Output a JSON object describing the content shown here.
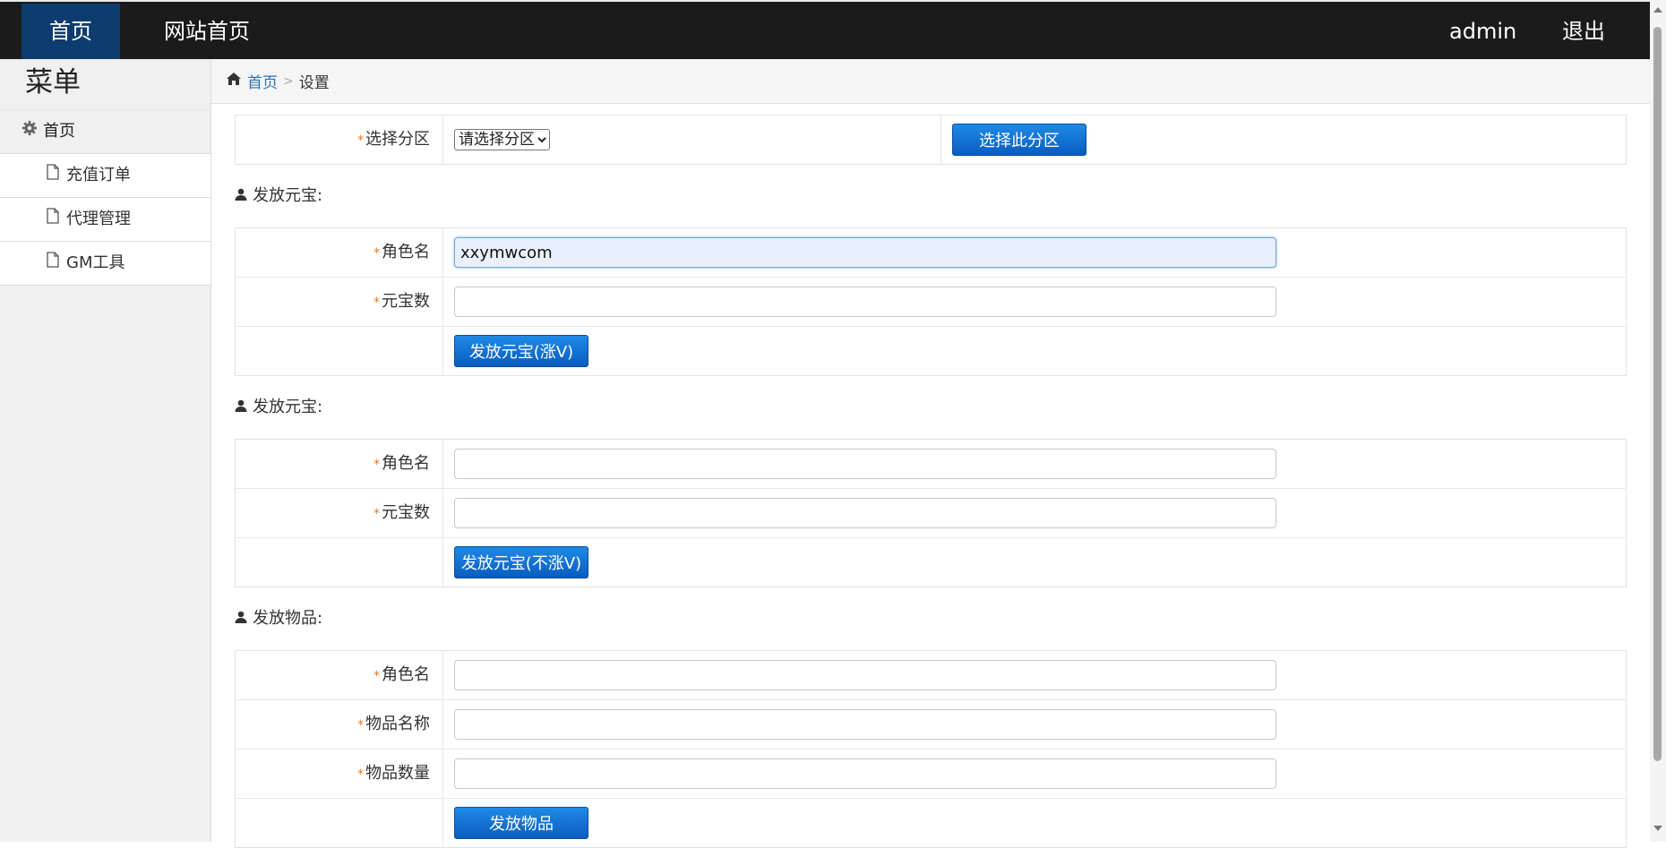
{
  "topbar": {
    "home_tab": "首页",
    "site_tab": "网站首页",
    "user": "admin",
    "logout": "退出"
  },
  "sidebar": {
    "title": "菜单",
    "home": "首页",
    "items": [
      {
        "label": "充值订单"
      },
      {
        "label": "代理管理"
      },
      {
        "label": "GM工具"
      }
    ]
  },
  "breadcrumb": {
    "home": "首页",
    "current": "设置"
  },
  "partition": {
    "label": "选择分区",
    "select_value": "请选择分区",
    "button": "选择此分区"
  },
  "section1": {
    "title": "发放元宝:",
    "role_label": "角色名",
    "role_value": "xxymwcom",
    "amount_label": "元宝数",
    "amount_value": "",
    "button": "发放元宝(涨V)"
  },
  "section2": {
    "title": "发放元宝:",
    "role_label": "角色名",
    "role_value": "",
    "amount_label": "元宝数",
    "amount_value": "",
    "button": "发放元宝(不涨V)"
  },
  "section3": {
    "title": "发放物品:",
    "role_label": "角色名",
    "role_value": "",
    "item_label": "物品名称",
    "item_value": "",
    "qty_label": "物品数量",
    "qty_value": "",
    "button": "发放物品"
  }
}
